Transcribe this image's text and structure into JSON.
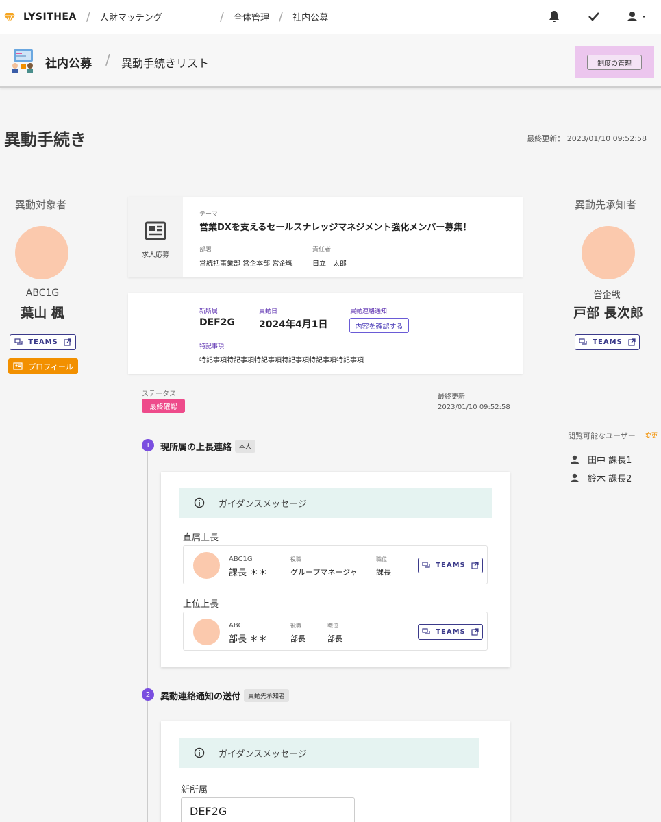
{
  "topnav": {
    "brand": "LYSITHEA",
    "app": "人財マッチング",
    "crumb1": "全体管理",
    "crumb2": "社内公募"
  },
  "header": {
    "title": "社内公募",
    "subtitle": "異動手続きリスト",
    "mgmt_button": "制度の管理"
  },
  "page": {
    "title": "異動手続き",
    "last_updated": "最終更新： 2023/01/10 09:52:58"
  },
  "left": {
    "title": "異動対象者",
    "org": "ABC1G",
    "name": "葉山 楓",
    "teams": "TEAMS",
    "profile": "プロフィール"
  },
  "right": {
    "title": "異動先承知者",
    "org": "営企戦",
    "name": "戸部 長次郎",
    "teams": "TEAMS"
  },
  "job_card": {
    "type_label": "求人応募",
    "theme_label": "テーマ",
    "theme": "営業DXを支えるセールスナレッジマネジメント強化メンバー募集！",
    "dept_label": "部署",
    "dept": "営統括事業部 営企本部 営企戦",
    "owner_label": "責任者",
    "owner": "日立　太郎"
  },
  "transfer": {
    "new_dept_label": "新所属",
    "new_dept": "DEF2G",
    "date_label": "異動日",
    "date": "2024年4月1日",
    "notice_label": "異動連絡通知",
    "notice_button": "内容を確認する",
    "notes_label": "特記事項",
    "notes": "特記事項特記事項特記事項特記事項特記事項特記事項"
  },
  "status": {
    "label": "ステータス",
    "value": "最終確認",
    "updated_label": "最終更新",
    "updated": "2023/01/10 09:52:58"
  },
  "step1": {
    "num": "1",
    "title": "現所属の上長連絡",
    "tag": "本人",
    "guide": "ガイダンスメッセージ",
    "direct_label": "直属上長",
    "upper_label": "上位上長",
    "direct": {
      "org": "ABC1G",
      "name": "課長 ＊＊",
      "role_label": "役職",
      "role": "グループマネージャ",
      "rank_label": "職位",
      "rank": "課長",
      "teams": "TEAMS"
    },
    "upper": {
      "org": "ABC",
      "name": "部長 ＊＊",
      "role_label": "役職",
      "role": "部長",
      "rank_label": "職位",
      "rank": "部長",
      "teams": "TEAMS"
    }
  },
  "step2": {
    "num": "2",
    "title": "異動連絡通知の送付",
    "tag": "異動先承知者",
    "guide": "ガイダンスメッセージ",
    "new_dept_label": "新所属",
    "new_dept_value": "DEF2G"
  },
  "viewers": {
    "title": "閲覧可能なユーザー",
    "change": "変更",
    "users": [
      "田中 課長1",
      "鈴木 課長2"
    ]
  }
}
